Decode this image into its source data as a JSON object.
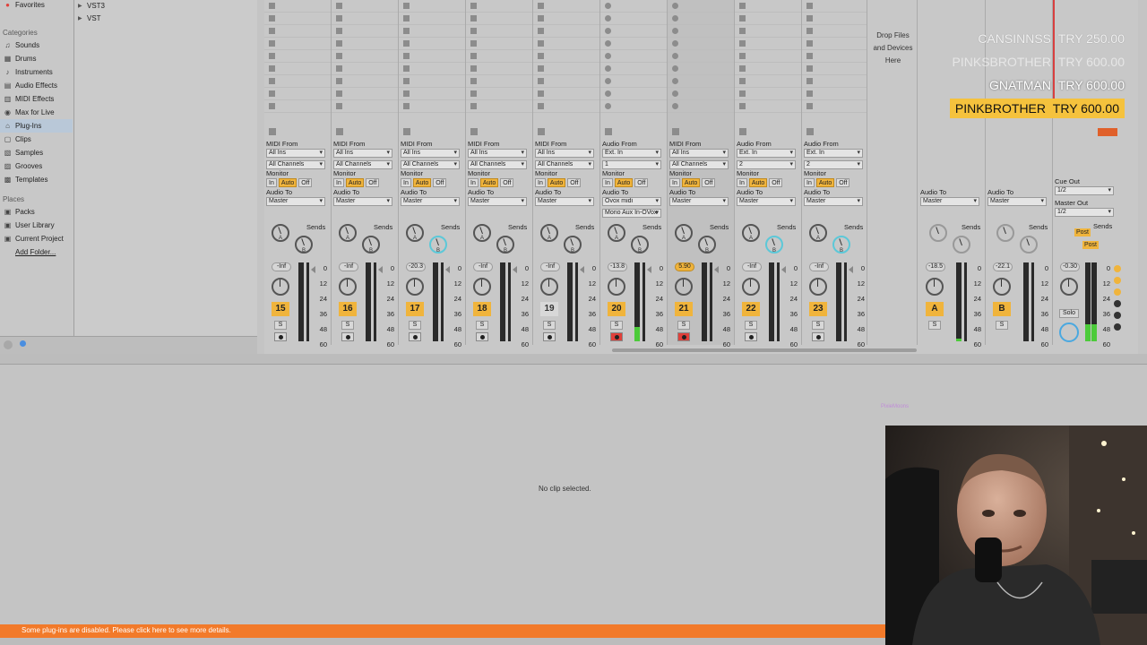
{
  "browser": {
    "favorites": "Favorites",
    "categories_header": "Categories",
    "categories": [
      "Sounds",
      "Drums",
      "Instruments",
      "Audio Effects",
      "MIDI Effects",
      "Max for Live",
      "Plug-Ins",
      "Clips",
      "Samples",
      "Grooves",
      "Templates"
    ],
    "category_icons": [
      "note-icon",
      "grid-icon",
      "instrument-icon",
      "audio-effects-icon",
      "midi-effects-icon",
      "max-icon",
      "plugin-icon",
      "clip-icon",
      "sample-icon",
      "groove-icon",
      "template-icon"
    ],
    "places_header": "Places",
    "places": [
      "Packs",
      "User Library",
      "Current Project",
      "Add Folder..."
    ],
    "items": [
      "VST3",
      "VST"
    ]
  },
  "mixer": {
    "tracks": [
      {
        "io_from": "MIDI From",
        "in1": "All Ins",
        "in2": "All Channels",
        "vol": "-Inf",
        "num": "15",
        "active": true,
        "arm": false
      },
      {
        "io_from": "MIDI From",
        "in1": "All Ins",
        "in2": "All Channels",
        "vol": "-Inf",
        "num": "16",
        "active": true,
        "arm": false
      },
      {
        "io_from": "MIDI From",
        "in1": "All Ins",
        "in2": "All Channels",
        "vol": "-20.3",
        "num": "17",
        "active": true,
        "arm": false
      },
      {
        "io_from": "MIDI From",
        "in1": "All Ins",
        "in2": "All Channels",
        "vol": "-Inf",
        "num": "18",
        "active": true,
        "arm": false
      },
      {
        "io_from": "MIDI From",
        "in1": "All Ins",
        "in2": "All Channels",
        "vol": "-Inf",
        "num": "19",
        "active": false,
        "arm": false
      },
      {
        "io_from": "Audio From",
        "in1": "Ext. In",
        "in2": "1",
        "vol": "-13.8",
        "num": "20",
        "active": true,
        "arm": true,
        "out": "Ovox midi",
        "out2": "Mono Aux In-OVox"
      },
      {
        "io_from": "MIDI From",
        "in1": "All Ins",
        "in2": "All Channels",
        "vol": "5.90",
        "num": "21",
        "active": true,
        "arm": true
      },
      {
        "io_from": "Audio From",
        "in1": "Ext. In",
        "in2": "2",
        "vol": "-Inf",
        "num": "22",
        "active": true,
        "arm": false
      },
      {
        "io_from": "Audio From",
        "in1": "Ext. In",
        "in2": "2",
        "vol": "-Inf",
        "num": "23",
        "active": true,
        "arm": false
      }
    ],
    "returns": [
      {
        "vol": "-18.5",
        "num": "A"
      },
      {
        "vol": "-22.1",
        "num": "B"
      }
    ],
    "master": {
      "vol": "-0.30",
      "cue_out_label": "Cue Out",
      "cue_out": "1/2",
      "master_out_label": "Master Out",
      "master_out": "1/2",
      "solo": "Solo",
      "post": "Post"
    },
    "labels": {
      "monitor": "Monitor",
      "audio_to": "Audio To",
      "master": "Master",
      "sends": "Sends",
      "in": "In",
      "auto": "Auto",
      "off": "Off",
      "s": "S",
      "knob_a": "A",
      "knob_b": "B"
    },
    "scale": [
      "0",
      "12",
      "24",
      "36",
      "48",
      "60"
    ],
    "drop_zone": [
      "Drop Files",
      "and Devices",
      "Here"
    ]
  },
  "donations": [
    {
      "name": "CANSINNSS",
      "amount": "TRY 250.00"
    },
    {
      "name": "PINKSBROTHER",
      "amount": "TRY 600.00"
    },
    {
      "name": "GNATMAN",
      "amount": "TRY 600.00"
    },
    {
      "name": "PINKBROTHER",
      "amount": "TRY 600.00"
    }
  ],
  "detail": {
    "no_clip": "No clip selected.",
    "watermark": "PixieMoons"
  },
  "status": {
    "message": "Some plug-ins are disabled. Please click here to see more details.",
    "color": "#f27a2a"
  },
  "colors": {
    "accent": "#f0b43c",
    "arm": "#e0403a",
    "meter": "#4ccb3a",
    "cyan_knob": "#5cc8d8"
  }
}
